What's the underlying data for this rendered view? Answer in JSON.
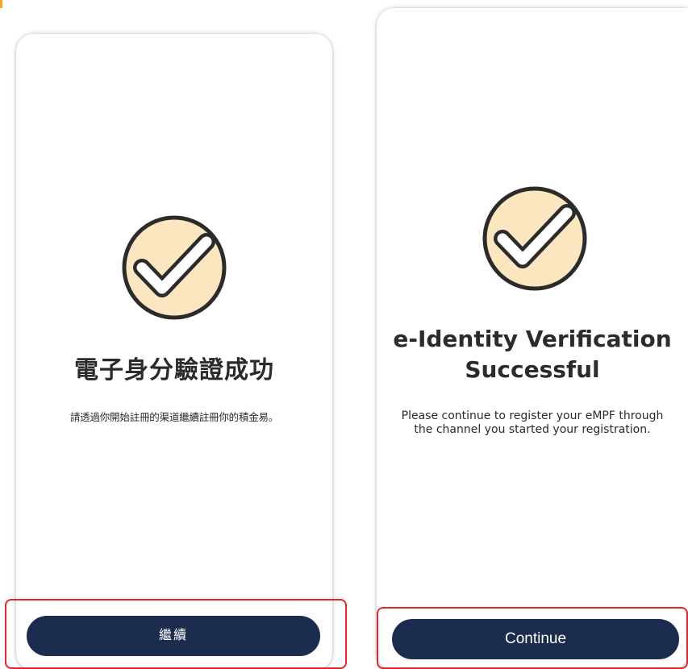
{
  "colors": {
    "button_bg": "#1c2c4e",
    "button_text": "#ffffff",
    "check_circle_fill": "#fbe6c0",
    "check_stroke": "#2b2b2b",
    "highlight_border": "#e3262b",
    "accent_mark": "#f5a623"
  },
  "screens": [
    {
      "lang": "zh-Hant",
      "icon": "success-check-icon",
      "title": "電子身分驗證成功",
      "description": "請透過你開始註冊的渠道繼續註冊你的積金易。",
      "button_label": "繼續"
    },
    {
      "lang": "en",
      "icon": "success-check-icon",
      "title": "e-Identity Verification Successful",
      "description": "Please continue to register your eMPF through the channel you started your registration.",
      "button_label": "Continue"
    }
  ]
}
